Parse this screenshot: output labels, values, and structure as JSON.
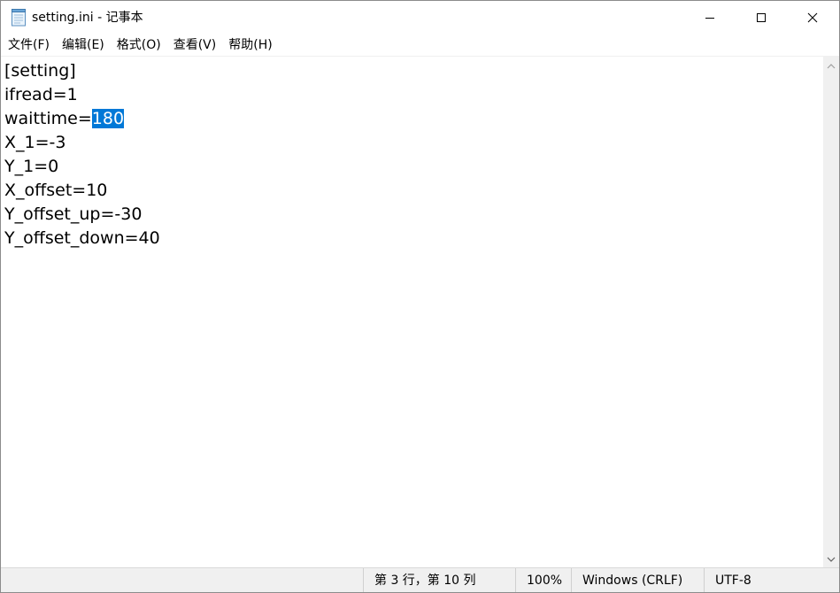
{
  "window": {
    "title": "setting.ini - 记事本",
    "app_icon": "notepad-icon"
  },
  "window_controls": {
    "minimize_icon": "minimize-icon",
    "maximize_icon": "maximize-icon",
    "close_icon": "close-icon"
  },
  "menu": [
    {
      "label": "文件(F)"
    },
    {
      "label": "编辑(E)"
    },
    {
      "label": "格式(O)"
    },
    {
      "label": "查看(V)"
    },
    {
      "label": "帮助(H)"
    }
  ],
  "editor": {
    "lines": {
      "l1": "[setting]",
      "l2": "ifread=1",
      "l3_before": "waittime=",
      "l3_selected": "180",
      "l4": "X_1=-3",
      "l5": "Y_1=0",
      "l6": "X_offset=10",
      "l7": "Y_offset_up=-30",
      "l8": "Y_offset_down=40"
    },
    "selection_color": "#0078d7"
  },
  "status": {
    "position": "第 3 行，第 10 列",
    "zoom": "100%",
    "line_ending": "Windows (CRLF)",
    "encoding": "UTF-8"
  }
}
